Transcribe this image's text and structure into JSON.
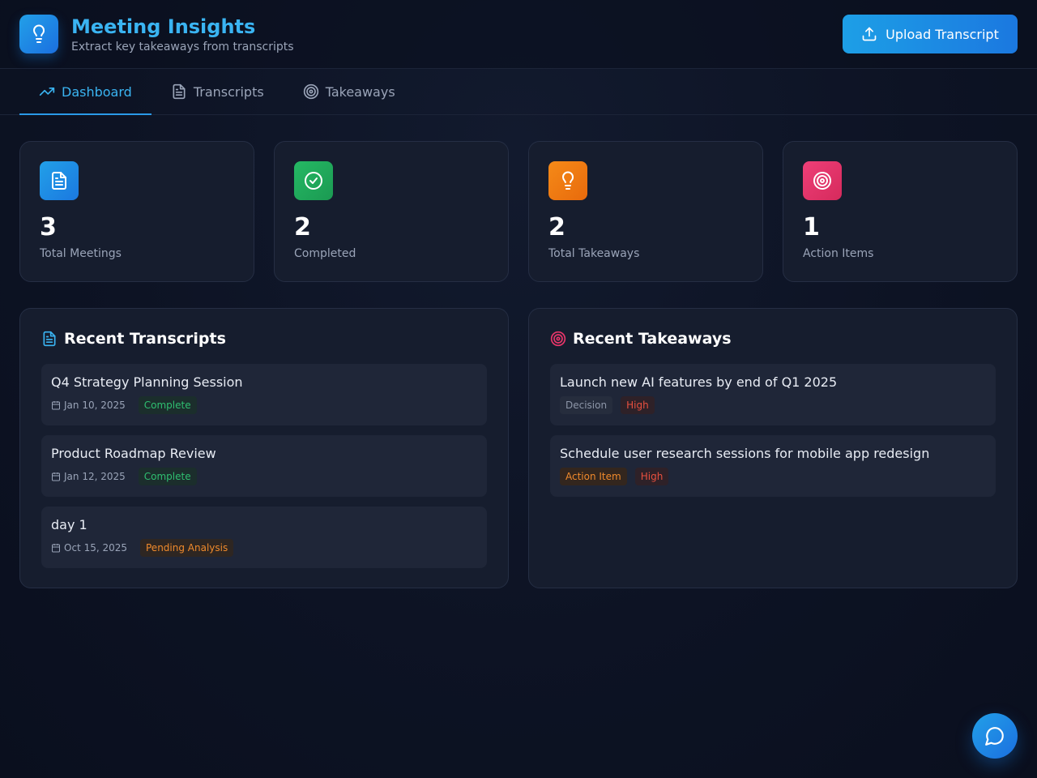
{
  "app": {
    "title": "Meeting Insights",
    "subtitle": "Extract key takeaways from transcripts",
    "upload_label": "Upload Transcript",
    "accent": "#3ab4f2"
  },
  "tabs": [
    {
      "label": "Dashboard",
      "icon": "trending-up-icon",
      "active": true
    },
    {
      "label": "Transcripts",
      "icon": "file-text-icon",
      "active": false
    },
    {
      "label": "Takeaways",
      "icon": "target-icon",
      "active": false
    }
  ],
  "stats": [
    {
      "value": "3",
      "label": "Total Meetings",
      "icon": "file-text-icon",
      "color": "#1f8fe4"
    },
    {
      "value": "2",
      "label": "Completed",
      "icon": "check-circle-icon",
      "color": "#22b05f"
    },
    {
      "value": "2",
      "label": "Total Takeaways",
      "icon": "lightbulb-icon",
      "color": "#f0780e"
    },
    {
      "value": "1",
      "label": "Action Items",
      "icon": "target-icon",
      "color": "#e8366a"
    }
  ],
  "recent_transcripts": {
    "title": "Recent Transcripts",
    "items": [
      {
        "title": "Q4 Strategy Planning Session",
        "date": "Jan 10, 2025",
        "status": "Complete"
      },
      {
        "title": "Product Roadmap Review",
        "date": "Jan 12, 2025",
        "status": "Complete"
      },
      {
        "title": "day 1",
        "date": "Oct 15, 2025",
        "status": "Pending Analysis"
      }
    ]
  },
  "recent_takeaways": {
    "title": "Recent Takeaways",
    "items": [
      {
        "title": "Launch new AI features by end of Q1 2025",
        "type": "Decision",
        "priority": "High"
      },
      {
        "title": "Schedule user research sessions for mobile app redesign",
        "type": "Action Item",
        "priority": "High"
      }
    ]
  }
}
